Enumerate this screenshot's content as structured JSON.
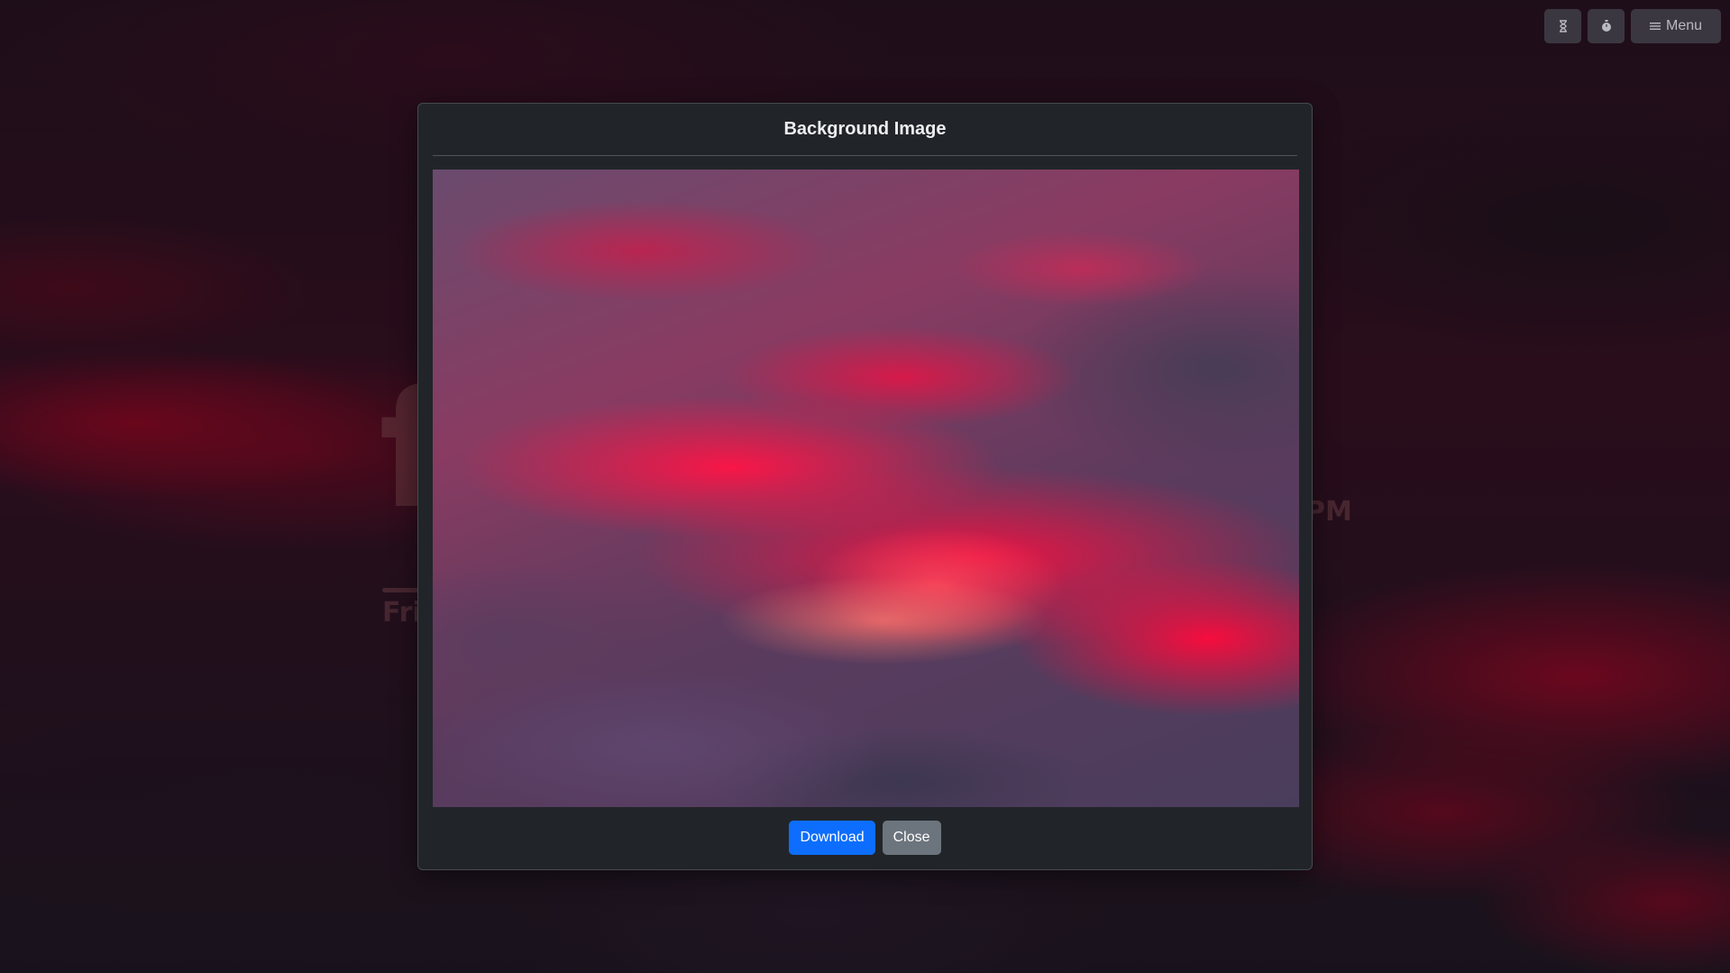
{
  "background": {
    "clock_text": "f",
    "ampm_text": "PM",
    "date_text": "Fri"
  },
  "toolbar": {
    "timer_icon": "hourglass-icon",
    "stopwatch_icon": "stopwatch-icon",
    "menu_icon": "hamburger-icon",
    "menu_label": "Menu"
  },
  "modal": {
    "title": "Background Image",
    "download_label": "Download",
    "close_label": "Close"
  },
  "colors": {
    "modal_bg": "#212529",
    "primary": "#0d6efd",
    "secondary": "#6c757d"
  }
}
